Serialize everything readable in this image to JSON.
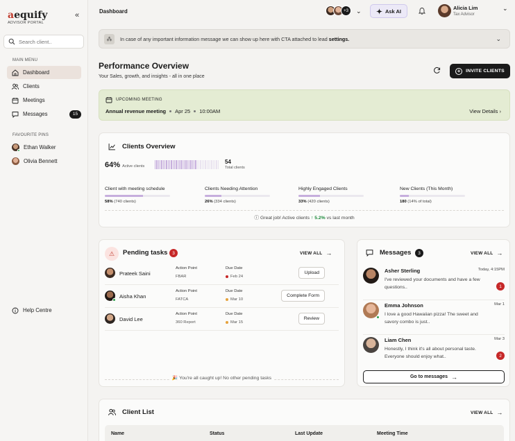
{
  "brand": {
    "logo_a": "a",
    "logo_rest": "equify",
    "subtitle": "ADVISOR PORTAL"
  },
  "search": {
    "placeholder": "Search client.."
  },
  "sidebar": {
    "main_menu_label": "MAIN MENU",
    "items": [
      {
        "label": "Dashboard",
        "icon": "home-icon",
        "active": true
      },
      {
        "label": "Clients",
        "icon": "users-icon"
      },
      {
        "label": "Meetings",
        "icon": "calendar-icon"
      },
      {
        "label": "Messages",
        "icon": "chat-icon",
        "badge": "15"
      }
    ],
    "pins_label": "FAVOURITE PINS",
    "pins": [
      {
        "name": "Ethan Walker"
      },
      {
        "name": "Olivia Bennett"
      }
    ],
    "help": "Help Centre"
  },
  "header": {
    "breadcrumb": "Dashboard",
    "avatar_more": "+3",
    "ask_ai": "Ask AI",
    "user_name": "Alicia Lim",
    "user_role": "Tax Advisor"
  },
  "banner": {
    "text": "In case of any important information message we can show up here with CTA attached to lead ",
    "link": "settings."
  },
  "performance": {
    "title": "Performance Overview",
    "subtitle": "Your Sales, growth, and insights - all in one place",
    "invite_label": "INVITE CLIENTS"
  },
  "upcoming": {
    "label": "UPCOMING MEETING",
    "title": "Annual revenue meeting",
    "date": "Apr 25",
    "time": "10:00AM",
    "cta": "View Details"
  },
  "clients_overview": {
    "title": "Clients Overview",
    "active_pct": "64%",
    "active_label": "Active clients",
    "active_fraction": 0.64,
    "total": "54",
    "total_label": "Total clients",
    "metrics": [
      {
        "title": "Client with meeting schedule",
        "pct": "58%",
        "detail": "(740 clients)",
        "fraction": 0.58
      },
      {
        "title": "Clients Needing Attention",
        "pct": "26%",
        "detail": "(334 clients)",
        "fraction": 0.26
      },
      {
        "title": "Highly Engaged Clients",
        "pct": "33%",
        "detail": "(420 clients)",
        "fraction": 0.33
      },
      {
        "title": "New Clients (This Month)",
        "pct": "180",
        "detail": "(14% of total)",
        "fraction": 0.14
      }
    ],
    "footer_pre": "Great job! Active clients",
    "footer_delta": "5.2%",
    "footer_post": "vs last month"
  },
  "pending": {
    "title": "Pending tasks",
    "count": "3",
    "view_all": "VIEW ALL",
    "action_label": "Action Point",
    "due_label": "Due Date",
    "tasks": [
      {
        "name": "Prateek Saini",
        "action": "FBAR",
        "due": "Feb 24",
        "due_color": "#c62828",
        "button": "Upload"
      },
      {
        "name": "Aisha Khan",
        "action": "FATCA",
        "due": "Mar 10",
        "due_color": "#e6a23c",
        "button": "Complete Form"
      },
      {
        "name": "David Lee",
        "action": "360 Report",
        "due": "Mar 15",
        "due_color": "#e6a23c",
        "button": "Review"
      }
    ],
    "footer": "You're all caught up! No other pending tasks"
  },
  "messages": {
    "title": "Messages",
    "count": "3",
    "view_all": "VIEW ALL",
    "items": [
      {
        "name": "Asher Sterling",
        "time": "Today, 4:15PM",
        "text": "I've reviewed your documents and have a few questions..",
        "unread": "1"
      },
      {
        "name": "Emma Johnson",
        "time": "Mar 1",
        "text": "I love a good Hawaiian pizza! The sweet and savory combo is just..",
        "unread": ""
      },
      {
        "name": "Liam Chen",
        "time": "Mar 3",
        "text": "Honestly, I think it's all about personal taste. Everyone should enjoy what..",
        "unread": "2"
      }
    ],
    "cta": "Go to messages"
  },
  "client_list": {
    "title": "Client List",
    "view_all": "VIEW ALL",
    "columns": [
      "Name",
      "Status",
      "Last Update",
      "Meeting Time"
    ]
  },
  "colors": {
    "accent_purple": "#c6aedd",
    "meeting_bg": "#e4ecd3",
    "danger": "#c62828",
    "success": "#1e8a3c"
  }
}
